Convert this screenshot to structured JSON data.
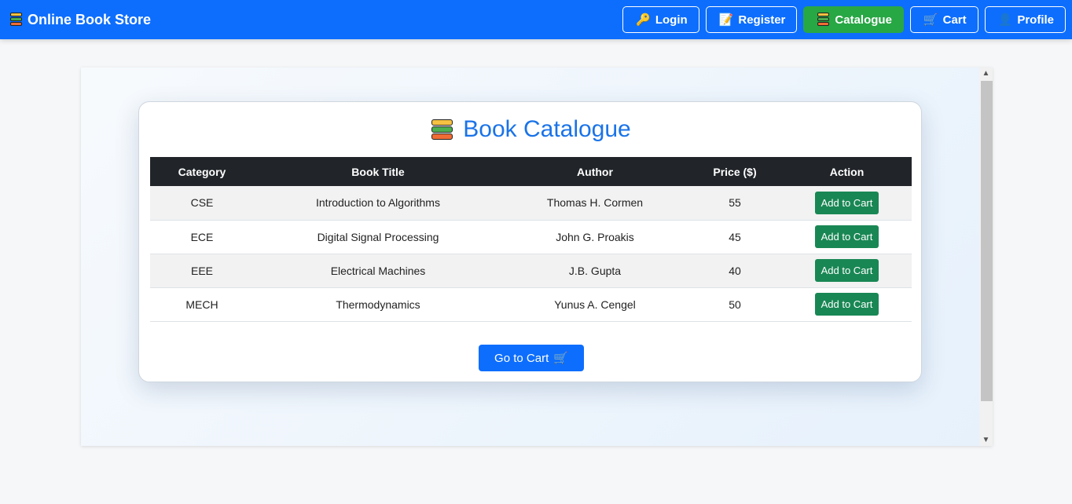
{
  "brand": {
    "title": "Online Book Store",
    "icon": "books-icon"
  },
  "nav": [
    {
      "label": "Login",
      "icon": "key-icon",
      "glyph": "🔑",
      "active": false
    },
    {
      "label": "Register",
      "icon": "memo-icon",
      "glyph": "📝",
      "active": false
    },
    {
      "label": "Catalogue",
      "icon": "books-icon",
      "glyph": "",
      "active": true
    },
    {
      "label": "Cart",
      "icon": "cart-icon",
      "glyph": "🛒",
      "active": false
    },
    {
      "label": "Profile",
      "icon": "user-icon",
      "glyph": "👤",
      "active": false
    }
  ],
  "catalogue": {
    "title": "Book Catalogue",
    "columns": [
      "Category",
      "Book Title",
      "Author",
      "Price ($)",
      "Action"
    ],
    "rows": [
      {
        "category": "CSE",
        "title": "Introduction to Algorithms",
        "author": "Thomas H. Cormen",
        "price": "55",
        "action": "Add to Cart"
      },
      {
        "category": "ECE",
        "title": "Digital Signal Processing",
        "author": "John G. Proakis",
        "price": "45",
        "action": "Add to Cart"
      },
      {
        "category": "EEE",
        "title": "Electrical Machines",
        "author": "J.B. Gupta",
        "price": "40",
        "action": "Add to Cart"
      },
      {
        "category": "MECH",
        "title": "Thermodynamics",
        "author": "Yunus A. Cengel",
        "price": "50",
        "action": "Add to Cart"
      }
    ],
    "go_to_cart": "Go to Cart",
    "go_to_cart_icon": "🛒"
  },
  "colors": {
    "primary": "#0d6efd",
    "success": "#198754",
    "active_nav": "#28a745",
    "header_dark": "#212529"
  }
}
